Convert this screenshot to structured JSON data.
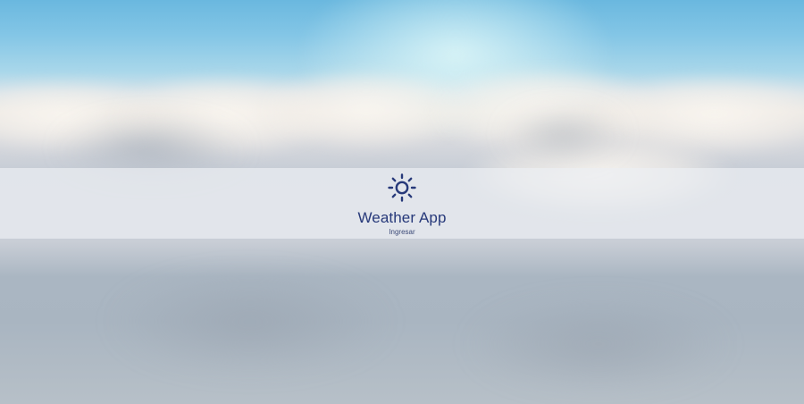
{
  "app": {
    "title": "Weather App",
    "login_link": "Ingresar",
    "logo_icon": "sun-icon"
  },
  "colors": {
    "brand": "#27397a",
    "sky_top": "#6ab8df",
    "band_overlay": "#eceef2"
  }
}
